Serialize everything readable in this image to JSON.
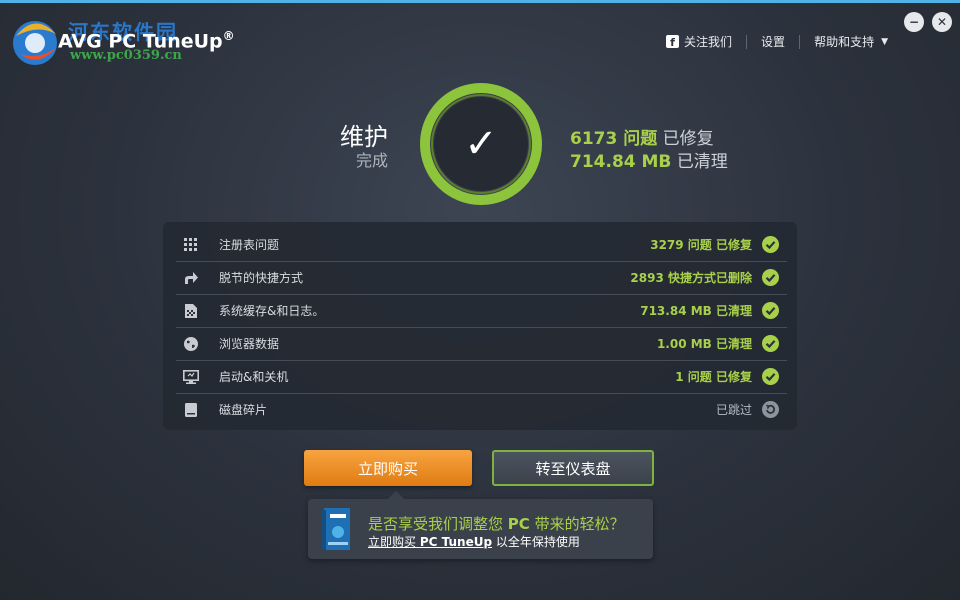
{
  "watermark": {
    "name": "河东软件园",
    "url": "www.pc0359.cn"
  },
  "app": {
    "title": "AVG  PC TuneUp",
    "registered": "®"
  },
  "nav": {
    "follow": "关注我们",
    "settings": "设置",
    "help": "帮助和支持",
    "facebook_icon": "facebook-icon"
  },
  "window": {
    "minimize": "−",
    "close": "✕"
  },
  "status": {
    "title": "维护",
    "subtitle": "完成",
    "checkmark": "✓",
    "issues_value": "6173 问题",
    "issues_label": "已修复",
    "space_value": "714.84 MB",
    "space_label": "已清理"
  },
  "results": [
    {
      "icon": "registry-grid-icon",
      "label": "注册表问题",
      "value": "3279 问题 已修复",
      "status": "done"
    },
    {
      "icon": "shortcut-arrow-icon",
      "label": "脱节的快捷方式",
      "value": "2893 快捷方式已删除",
      "status": "done"
    },
    {
      "icon": "cache-file-icon",
      "label": "系统缓存&和日志。",
      "value": "713.84 MB 已清理",
      "status": "done"
    },
    {
      "icon": "globe-icon",
      "label": "浏览器数据",
      "value": "1.00 MB 已清理",
      "status": "done"
    },
    {
      "icon": "monitor-icon",
      "label": "启动&和关机",
      "value": "1 问题 已修复",
      "status": "done"
    },
    {
      "icon": "disk-icon",
      "label": "磁盘碎片",
      "value": "已跳过",
      "status": "skipped"
    }
  ],
  "buttons": {
    "buy": "立即购买",
    "dashboard": "转至仪表盘"
  },
  "promo": {
    "question_part1": "是否享受我们调整您",
    "question_pc": "PC",
    "question_part2": "带来的轻松？",
    "link_prefix": "立即购买",
    "link_product": "PC TuneUp",
    "suffix": "以全年保持使用"
  },
  "colors": {
    "accent_green": "#a8d04a",
    "ring_green": "#8cc43c",
    "buy_orange": "#f09a35",
    "top_blue": "#4fb3e8"
  }
}
